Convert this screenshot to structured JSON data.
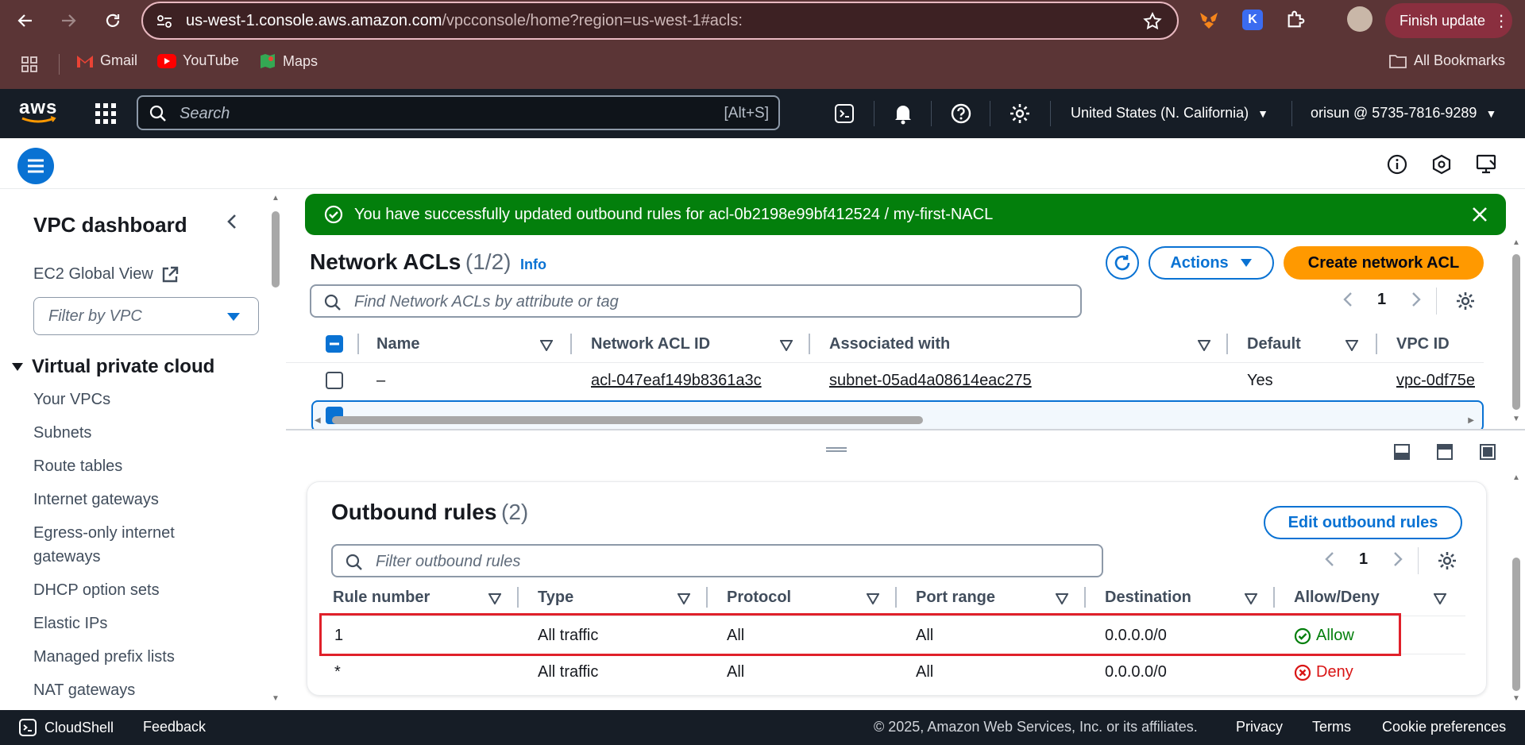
{
  "browser": {
    "url_host": "us-west-1.console.aws.amazon.com",
    "url_path": "/vpcconsole/home?region=us-west-1#acls:",
    "finish_update": "Finish update",
    "bookmarks": [
      "Gmail",
      "YouTube",
      "Maps"
    ],
    "all_bookmarks": "All Bookmarks"
  },
  "aws_header": {
    "logo": "aws",
    "search_placeholder": "Search",
    "search_shortcut": "[Alt+S]",
    "region": "United States (N. California)",
    "account": "orisun @ 5735-7816-9289"
  },
  "sidebar": {
    "title": "VPC dashboard",
    "global_view": "EC2 Global View",
    "filter_placeholder": "Filter by VPC",
    "section": "Virtual private cloud",
    "items": [
      "Your VPCs",
      "Subnets",
      "Route tables",
      "Internet gateways",
      "Egress-only internet",
      "gateways",
      "DHCP option sets",
      "Elastic IPs",
      "Managed prefix lists",
      "NAT gateways"
    ]
  },
  "flash": {
    "message": "You have successfully updated outbound rules for acl-0b2198e99bf412524 / my-first-NACL"
  },
  "acl_panel": {
    "title": "Network ACLs",
    "count": "(1/2)",
    "info": "Info",
    "actions": "Actions",
    "create": "Create network ACL",
    "search_placeholder": "Find Network ACLs by attribute or tag",
    "page": "1",
    "columns": [
      "Name",
      "Network ACL ID",
      "Associated with",
      "Default",
      "VPC ID"
    ],
    "rows": [
      {
        "name": "–",
        "id": "acl-047eaf149b8361a3c",
        "assoc": "subnet-05ad4a08614eac275",
        "default": "Yes",
        "vpc": "vpc-0df75e"
      }
    ]
  },
  "outbound": {
    "title": "Outbound rules",
    "count": "(2)",
    "edit": "Edit outbound rules",
    "filter_placeholder": "Filter outbound rules",
    "page": "1",
    "columns": [
      "Rule number",
      "Type",
      "Protocol",
      "Port range",
      "Destination",
      "Allow/Deny"
    ],
    "rows": [
      {
        "rule": "1",
        "type": "All traffic",
        "protocol": "All",
        "port": "All",
        "dest": "0.0.0.0/0",
        "action": "Allow"
      },
      {
        "rule": "*",
        "type": "All traffic",
        "protocol": "All",
        "port": "All",
        "dest": "0.0.0.0/0",
        "action": "Deny"
      }
    ]
  },
  "footer": {
    "cloudshell": "CloudShell",
    "feedback": "Feedback",
    "copyright": "© 2025, Amazon Web Services, Inc. or its affiliates.",
    "privacy": "Privacy",
    "terms": "Terms",
    "cookies": "Cookie preferences"
  },
  "colors": {
    "primary": "#0972d3",
    "orange": "#ff9900",
    "success": "#037f0c",
    "danger": "#d91515",
    "highlight": "#e0202a"
  }
}
